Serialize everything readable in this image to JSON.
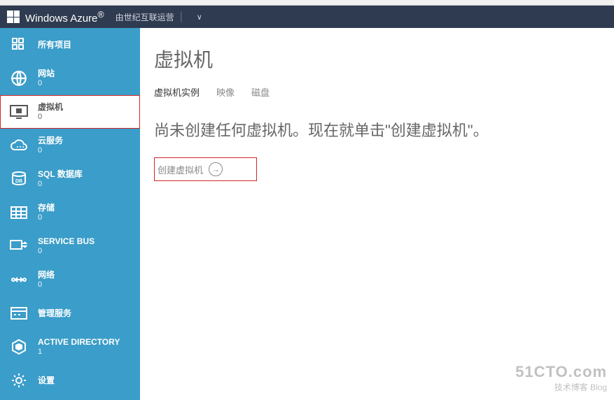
{
  "header": {
    "brand": "Windows Azure",
    "brand_suffix": "®",
    "operator": "由世纪互联运营",
    "chevron": "∨"
  },
  "sidebar": {
    "items": [
      {
        "label": "所有项目",
        "count": "",
        "icon": "grid-icon"
      },
      {
        "label": "网站",
        "count": "0",
        "icon": "globe-icon"
      },
      {
        "label": "虚拟机",
        "count": "0",
        "icon": "vm-icon",
        "active": true,
        "highlight": true
      },
      {
        "label": "云服务",
        "count": "0",
        "icon": "cloud-icon"
      },
      {
        "label": "SQL 数据库",
        "count": "0",
        "icon": "db-icon"
      },
      {
        "label": "存储",
        "count": "0",
        "icon": "storage-icon"
      },
      {
        "label": "SERVICE BUS",
        "count": "0",
        "icon": "servicebus-icon"
      },
      {
        "label": "网络",
        "count": "0",
        "icon": "network-icon"
      },
      {
        "label": "管理服务",
        "count": "",
        "icon": "mgmt-icon"
      },
      {
        "label": "ACTIVE DIRECTORY",
        "count": "1",
        "icon": "ad-icon"
      },
      {
        "label": "设置",
        "count": "",
        "icon": "gear-icon"
      }
    ]
  },
  "content": {
    "title": "虚拟机",
    "tabs": [
      {
        "label": "虚拟机实例",
        "active": true
      },
      {
        "label": "映像",
        "active": false
      },
      {
        "label": "磁盘",
        "active": false
      }
    ],
    "empty_message": "尚未创建任何虚拟机。现在就单击\"创建虚拟机\"。",
    "create_label": "创建虚拟机"
  },
  "watermark": {
    "main": "51CTO.com",
    "sub": "技术博客  Blog"
  }
}
